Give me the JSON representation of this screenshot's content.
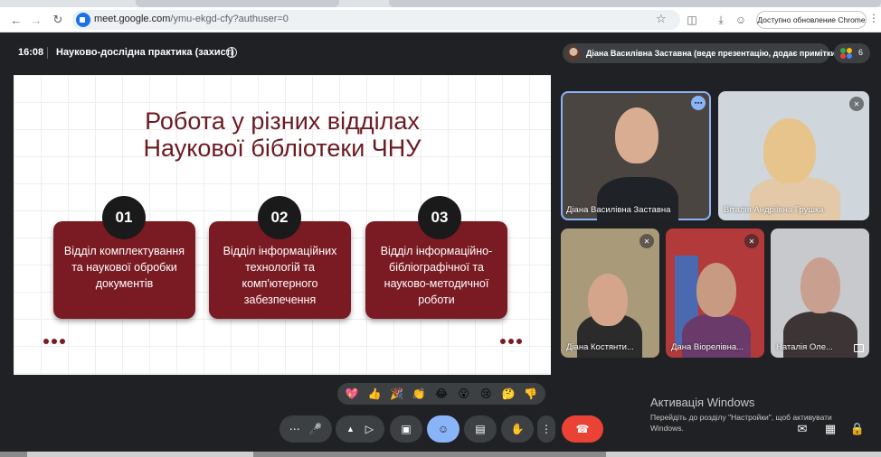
{
  "browser": {
    "url_host": "meet.google.com",
    "url_path": "/ymu-ekgd-cfy?authuser=0",
    "update_button": "Доступно обновление Chrome"
  },
  "meet": {
    "time": "16:08",
    "title": "Науково-дослідна практика (захист)",
    "presenter_chip": "Діана Василівна Заставна (веде презентацію, додає примітки)",
    "people_count": "6"
  },
  "slide": {
    "title_line1": "Робота у різних відділах",
    "title_line2": "Наукової бібліотеки ЧНУ",
    "cards": [
      {
        "number": "01",
        "text": "Відділ комплектування та наукової обробки документів"
      },
      {
        "number": "02",
        "text": "Відділ інформаційних технологій та комп'ютерного забезпечення"
      },
      {
        "number": "03",
        "text": "Відділ інформаційно-бібліографічної та науково-методичної роботи"
      }
    ]
  },
  "participants": [
    {
      "name": "Діана Василівна Заставна",
      "muted": false,
      "speaking": true
    },
    {
      "name": "Віталія Андріївна Грушка",
      "muted": true,
      "speaking": false
    },
    {
      "name": "Діана Костянти...",
      "muted": true,
      "speaking": false
    },
    {
      "name": "Дана Віорелівна...",
      "muted": true,
      "speaking": false
    },
    {
      "name": "Наталія Оле...",
      "muted": false,
      "speaking": false
    }
  ],
  "reactions": [
    "💖",
    "👍",
    "🎉",
    "👏",
    "😂",
    "😮",
    "😢",
    "🤔",
    "👎"
  ],
  "watermark": {
    "heading": "Активація Windows",
    "subtext": "Перейдіть до розділу \"Настройки\", щоб активувати Windows."
  },
  "colors": {
    "slide_accent": "#7a1a22",
    "end_call": "#ea4335",
    "active_control": "#8ab4f8"
  }
}
